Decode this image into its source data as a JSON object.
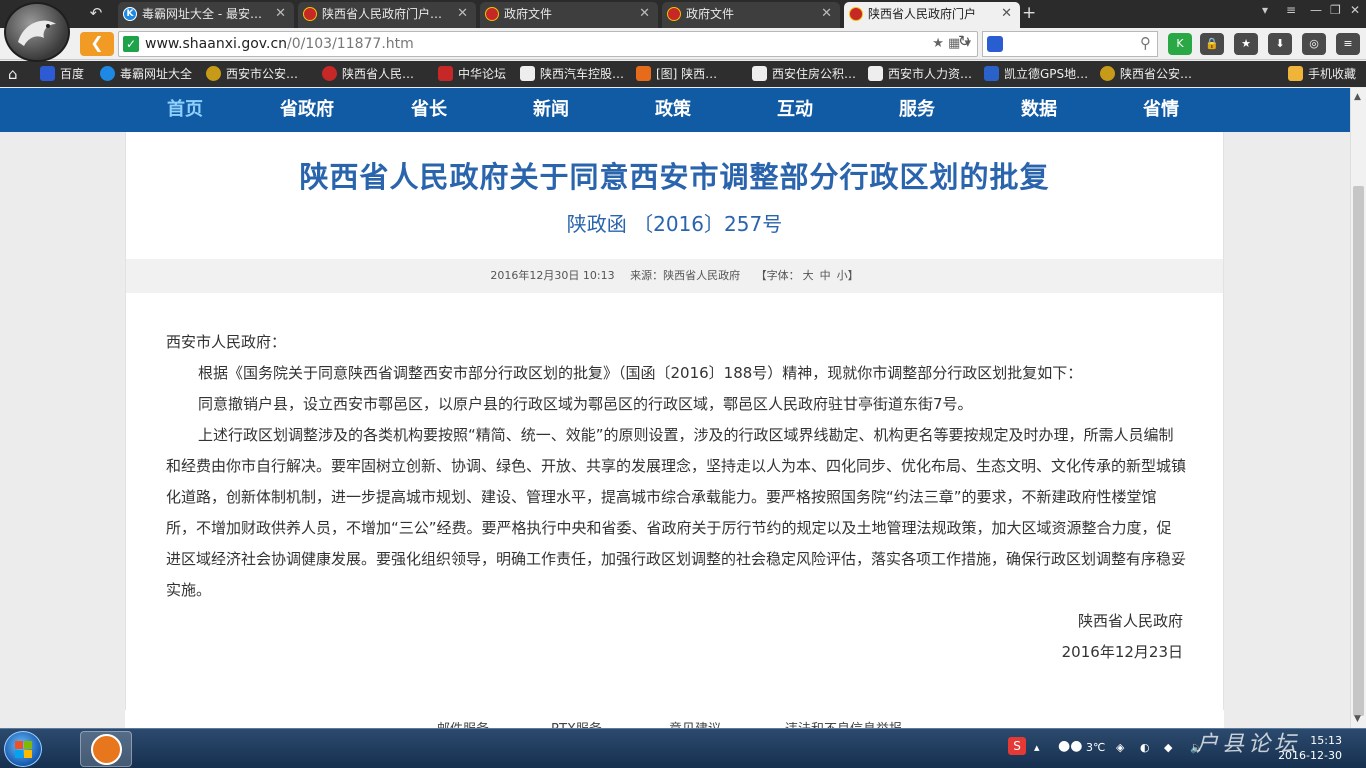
{
  "tabs": [
    {
      "title": "毒霸网址大全 - 最安…",
      "icon": "k-icon",
      "active": false
    },
    {
      "title": "陕西省人民政府门户…",
      "icon": "emblem-icon",
      "active": false
    },
    {
      "title": "政府文件",
      "icon": "emblem-icon",
      "active": false
    },
    {
      "title": "政府文件",
      "icon": "emblem-icon",
      "active": false
    },
    {
      "title": "陕西省人民政府门户",
      "icon": "emblem-icon",
      "active": true
    }
  ],
  "address": {
    "domain": "www.shaanxi.gov.cn",
    "path": "/0/103/11877.htm"
  },
  "bookmarks": [
    {
      "label": "百度",
      "icon": "paw-icon"
    },
    {
      "label": "毒霸网址大全",
      "icon": "k-icon"
    },
    {
      "label": "西安市公安…",
      "icon": "police-icon"
    },
    {
      "label": "陕西省人民…",
      "icon": "emblem-icon"
    },
    {
      "label": "中华论坛",
      "icon": "forum-icon"
    },
    {
      "label": "陕西汽车控股…",
      "icon": "page-icon"
    },
    {
      "label": "[图] 陕西…",
      "icon": "jia-icon"
    },
    {
      "label": "西安住房公积…",
      "icon": "page-icon"
    },
    {
      "label": "西安市人力资…",
      "icon": "page-icon"
    },
    {
      "label": "凯立德GPS地…",
      "icon": "gps-icon"
    },
    {
      "label": "陕西省公安…",
      "icon": "police-icon"
    },
    {
      "label": "手机收藏",
      "icon": "folder-icon"
    }
  ],
  "site_nav": [
    "首页",
    "省政府",
    "省长",
    "新闻",
    "政策",
    "互动",
    "服务",
    "数据",
    "省情"
  ],
  "document": {
    "title": "陕西省人民政府关于同意西安市调整部分行政区划的批复",
    "number": "陕政函 〔2016〕257号",
    "meta": {
      "date": "2016年12月30日 10:13",
      "source": "来源：陕西省人民政府",
      "font_label": "【字体：",
      "font_large": "大",
      "font_medium": "中",
      "font_small": "小】"
    },
    "salutation": "西安市人民政府：",
    "paragraphs": [
      "根据《国务院关于同意陕西省调整西安市部分行政区划的批复》（国函〔2016〕188号）精神，现就你市调整部分行政区划批复如下：",
      "同意撤销户县，设立西安市鄠邑区，以原户县的行政区域为鄠邑区的行政区域，鄠邑区人民政府驻甘亭街道东街7号。",
      "上述行政区划调整涉及的各类机构要按照“精简、统一、效能”的原则设置，涉及的行政区域界线勘定、机构更名等要按规定及时办理，所需人员编制和经费由你市自行解决。要牢固树立创新、协调、绿色、开放、共享的发展理念，坚持走以人为本、四化同步、优化布局、生态文明、文化传承的新型城镇化道路，创新体制机制，进一步提高城市规划、建设、管理水平，提高城市综合承载能力。要严格按照国务院“约法三章”的要求，不新建政府性楼堂馆所，不增加财政供养人员，不增加“三公”经费。要严格执行中央和省委、省政府关于厉行节约的规定以及土地管理法规政策，加大区域资源整合力度，促进区域经济社会协调健康发展。要强化组织领导，明确工作责任，加强行政区划调整的社会稳定风险评估，落实各项工作措施，确保行政区划调整有序稳妥实施。"
    ],
    "signature_org": "陕西省人民政府",
    "signature_date": "2016年12月23日"
  },
  "footer_links": [
    "邮件服务",
    "RTX服务",
    "意见建议",
    "违法和不良信息举报"
  ],
  "taskbar": {
    "weather": "3℃",
    "time": "15:13",
    "date": "2016-12-30"
  },
  "watermark": "户县论坛",
  "colors": {
    "nav_blue": "#115ba5",
    "title_blue": "#2a64ad",
    "back_orange": "#f19a24"
  }
}
